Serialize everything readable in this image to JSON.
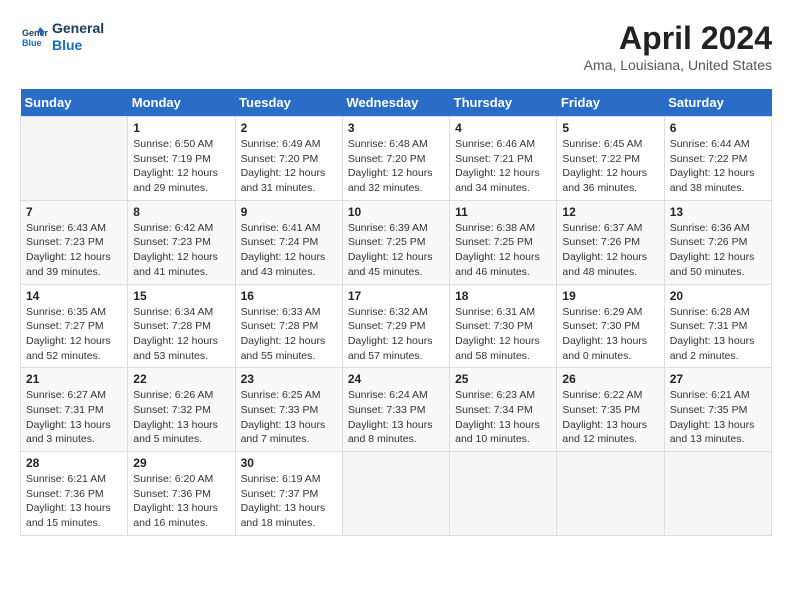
{
  "logo": {
    "line1": "General",
    "line2": "Blue"
  },
  "title": "April 2024",
  "location": "Ama, Louisiana, United States",
  "days_header": [
    "Sunday",
    "Monday",
    "Tuesday",
    "Wednesday",
    "Thursday",
    "Friday",
    "Saturday"
  ],
  "weeks": [
    [
      {
        "day": "",
        "sunrise": "",
        "sunset": "",
        "daylight": ""
      },
      {
        "day": "1",
        "sunrise": "Sunrise: 6:50 AM",
        "sunset": "Sunset: 7:19 PM",
        "daylight": "Daylight: 12 hours and 29 minutes."
      },
      {
        "day": "2",
        "sunrise": "Sunrise: 6:49 AM",
        "sunset": "Sunset: 7:20 PM",
        "daylight": "Daylight: 12 hours and 31 minutes."
      },
      {
        "day": "3",
        "sunrise": "Sunrise: 6:48 AM",
        "sunset": "Sunset: 7:20 PM",
        "daylight": "Daylight: 12 hours and 32 minutes."
      },
      {
        "day": "4",
        "sunrise": "Sunrise: 6:46 AM",
        "sunset": "Sunset: 7:21 PM",
        "daylight": "Daylight: 12 hours and 34 minutes."
      },
      {
        "day": "5",
        "sunrise": "Sunrise: 6:45 AM",
        "sunset": "Sunset: 7:22 PM",
        "daylight": "Daylight: 12 hours and 36 minutes."
      },
      {
        "day": "6",
        "sunrise": "Sunrise: 6:44 AM",
        "sunset": "Sunset: 7:22 PM",
        "daylight": "Daylight: 12 hours and 38 minutes."
      }
    ],
    [
      {
        "day": "7",
        "sunrise": "Sunrise: 6:43 AM",
        "sunset": "Sunset: 7:23 PM",
        "daylight": "Daylight: 12 hours and 39 minutes."
      },
      {
        "day": "8",
        "sunrise": "Sunrise: 6:42 AM",
        "sunset": "Sunset: 7:23 PM",
        "daylight": "Daylight: 12 hours and 41 minutes."
      },
      {
        "day": "9",
        "sunrise": "Sunrise: 6:41 AM",
        "sunset": "Sunset: 7:24 PM",
        "daylight": "Daylight: 12 hours and 43 minutes."
      },
      {
        "day": "10",
        "sunrise": "Sunrise: 6:39 AM",
        "sunset": "Sunset: 7:25 PM",
        "daylight": "Daylight: 12 hours and 45 minutes."
      },
      {
        "day": "11",
        "sunrise": "Sunrise: 6:38 AM",
        "sunset": "Sunset: 7:25 PM",
        "daylight": "Daylight: 12 hours and 46 minutes."
      },
      {
        "day": "12",
        "sunrise": "Sunrise: 6:37 AM",
        "sunset": "Sunset: 7:26 PM",
        "daylight": "Daylight: 12 hours and 48 minutes."
      },
      {
        "day": "13",
        "sunrise": "Sunrise: 6:36 AM",
        "sunset": "Sunset: 7:26 PM",
        "daylight": "Daylight: 12 hours and 50 minutes."
      }
    ],
    [
      {
        "day": "14",
        "sunrise": "Sunrise: 6:35 AM",
        "sunset": "Sunset: 7:27 PM",
        "daylight": "Daylight: 12 hours and 52 minutes."
      },
      {
        "day": "15",
        "sunrise": "Sunrise: 6:34 AM",
        "sunset": "Sunset: 7:28 PM",
        "daylight": "Daylight: 12 hours and 53 minutes."
      },
      {
        "day": "16",
        "sunrise": "Sunrise: 6:33 AM",
        "sunset": "Sunset: 7:28 PM",
        "daylight": "Daylight: 12 hours and 55 minutes."
      },
      {
        "day": "17",
        "sunrise": "Sunrise: 6:32 AM",
        "sunset": "Sunset: 7:29 PM",
        "daylight": "Daylight: 12 hours and 57 minutes."
      },
      {
        "day": "18",
        "sunrise": "Sunrise: 6:31 AM",
        "sunset": "Sunset: 7:30 PM",
        "daylight": "Daylight: 12 hours and 58 minutes."
      },
      {
        "day": "19",
        "sunrise": "Sunrise: 6:29 AM",
        "sunset": "Sunset: 7:30 PM",
        "daylight": "Daylight: 13 hours and 0 minutes."
      },
      {
        "day": "20",
        "sunrise": "Sunrise: 6:28 AM",
        "sunset": "Sunset: 7:31 PM",
        "daylight": "Daylight: 13 hours and 2 minutes."
      }
    ],
    [
      {
        "day": "21",
        "sunrise": "Sunrise: 6:27 AM",
        "sunset": "Sunset: 7:31 PM",
        "daylight": "Daylight: 13 hours and 3 minutes."
      },
      {
        "day": "22",
        "sunrise": "Sunrise: 6:26 AM",
        "sunset": "Sunset: 7:32 PM",
        "daylight": "Daylight: 13 hours and 5 minutes."
      },
      {
        "day": "23",
        "sunrise": "Sunrise: 6:25 AM",
        "sunset": "Sunset: 7:33 PM",
        "daylight": "Daylight: 13 hours and 7 minutes."
      },
      {
        "day": "24",
        "sunrise": "Sunrise: 6:24 AM",
        "sunset": "Sunset: 7:33 PM",
        "daylight": "Daylight: 13 hours and 8 minutes."
      },
      {
        "day": "25",
        "sunrise": "Sunrise: 6:23 AM",
        "sunset": "Sunset: 7:34 PM",
        "daylight": "Daylight: 13 hours and 10 minutes."
      },
      {
        "day": "26",
        "sunrise": "Sunrise: 6:22 AM",
        "sunset": "Sunset: 7:35 PM",
        "daylight": "Daylight: 13 hours and 12 minutes."
      },
      {
        "day": "27",
        "sunrise": "Sunrise: 6:21 AM",
        "sunset": "Sunset: 7:35 PM",
        "daylight": "Daylight: 13 hours and 13 minutes."
      }
    ],
    [
      {
        "day": "28",
        "sunrise": "Sunrise: 6:21 AM",
        "sunset": "Sunset: 7:36 PM",
        "daylight": "Daylight: 13 hours and 15 minutes."
      },
      {
        "day": "29",
        "sunrise": "Sunrise: 6:20 AM",
        "sunset": "Sunset: 7:36 PM",
        "daylight": "Daylight: 13 hours and 16 minutes."
      },
      {
        "day": "30",
        "sunrise": "Sunrise: 6:19 AM",
        "sunset": "Sunset: 7:37 PM",
        "daylight": "Daylight: 13 hours and 18 minutes."
      },
      {
        "day": "",
        "sunrise": "",
        "sunset": "",
        "daylight": ""
      },
      {
        "day": "",
        "sunrise": "",
        "sunset": "",
        "daylight": ""
      },
      {
        "day": "",
        "sunrise": "",
        "sunset": "",
        "daylight": ""
      },
      {
        "day": "",
        "sunrise": "",
        "sunset": "",
        "daylight": ""
      }
    ]
  ]
}
